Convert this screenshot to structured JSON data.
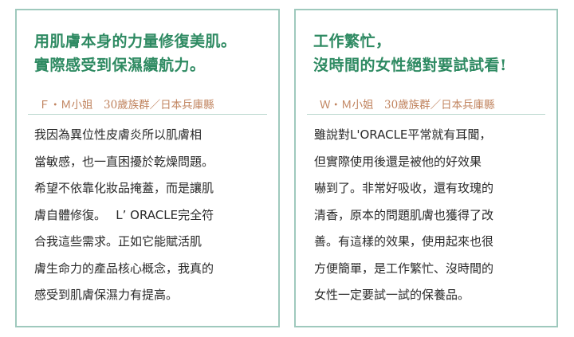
{
  "cards": [
    {
      "headline": [
        "用肌膚本身的力量修復美肌。",
        "實際感受到保濕續航力。"
      ],
      "author": "Ｆ・Ｍ小姐　30歲族群／日本兵庫縣",
      "body": [
        "我因為異位性皮膚炎所以肌膚相",
        "當敏感，也一直困擾於乾燥問題。",
        "希望不依靠化妝品掩蓋，而是讓肌",
        "膚自體修復。　 L’ ORACLE完全符",
        "合我這些需求。正如它能賦活肌",
        "膚生命力的產品核心概念，我真的",
        "感受到肌膚保濕力有提高。"
      ]
    },
    {
      "headline": [
        "工作繁忙，",
        "沒時間的女性絕對要試試看!"
      ],
      "author": "Ｗ・Ｍ小姐　30歲族群／日本兵庫縣",
      "body": [
        "雖說對L'ORACLE平常就有耳聞，",
        "但實際使用後還是被他的好效果",
        "嚇到了。非常好吸收，還有玫瑰的",
        "清香，原本的問題肌膚也獲得了改",
        "善。有這樣的效果，使用起來也很",
        "方便簡單，是工作繁忙、沒時間的",
        "女性一定要試一試的保養品。"
      ]
    }
  ],
  "colors": {
    "headline": "#2e8a62",
    "author": "#c0835e",
    "border": "#9fc9bd",
    "body_text": "#2a2a2a"
  }
}
